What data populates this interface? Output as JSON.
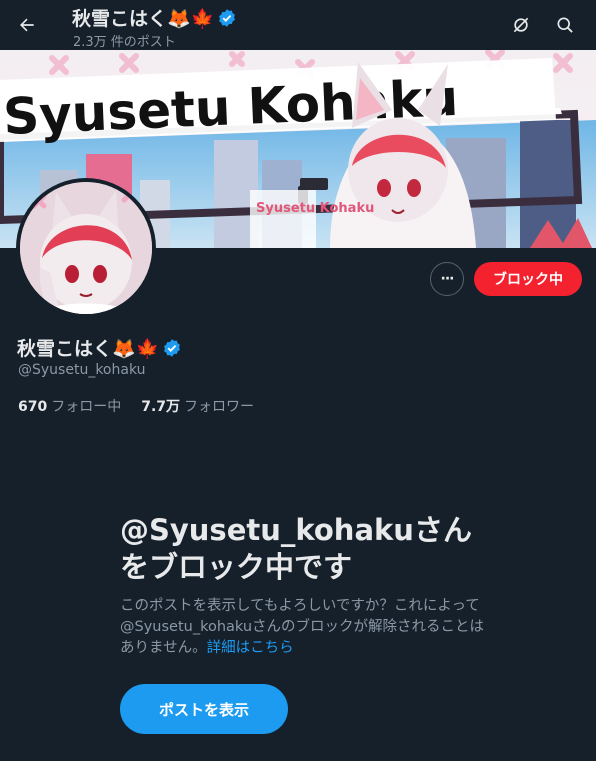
{
  "header": {
    "back_label": "←",
    "title": "秋雪こはく🦊🍁",
    "post_count": "2.3万 件のポスト"
  },
  "banner": {
    "title_text": "Syusetu Kohaku",
    "sign_text": "Syusetu Kohaku"
  },
  "profile": {
    "name": "秋雪こはく🦊🍁",
    "handle": "@Syusetu_kohaku",
    "following_count": "670",
    "following_label": "フォロー中",
    "followers_count": "7.7万",
    "followers_label": "フォロワー"
  },
  "actions": {
    "more_label": "···",
    "block_label": "ブロック中"
  },
  "blocked_panel": {
    "title": "@Syusetu_kohakuさんをブロック中です",
    "description": "このポストを表示してもよろしいですか？これによって@Syusetu_kohakuさんのブロックが解除されることはありません。",
    "link_text": "詳細はこちら",
    "button_label": "ポストを表示"
  },
  "colors": {
    "background": "#15202b",
    "accent": "#1d9bf0",
    "block_red": "#f4212e",
    "verified": "#1d9bf0"
  }
}
